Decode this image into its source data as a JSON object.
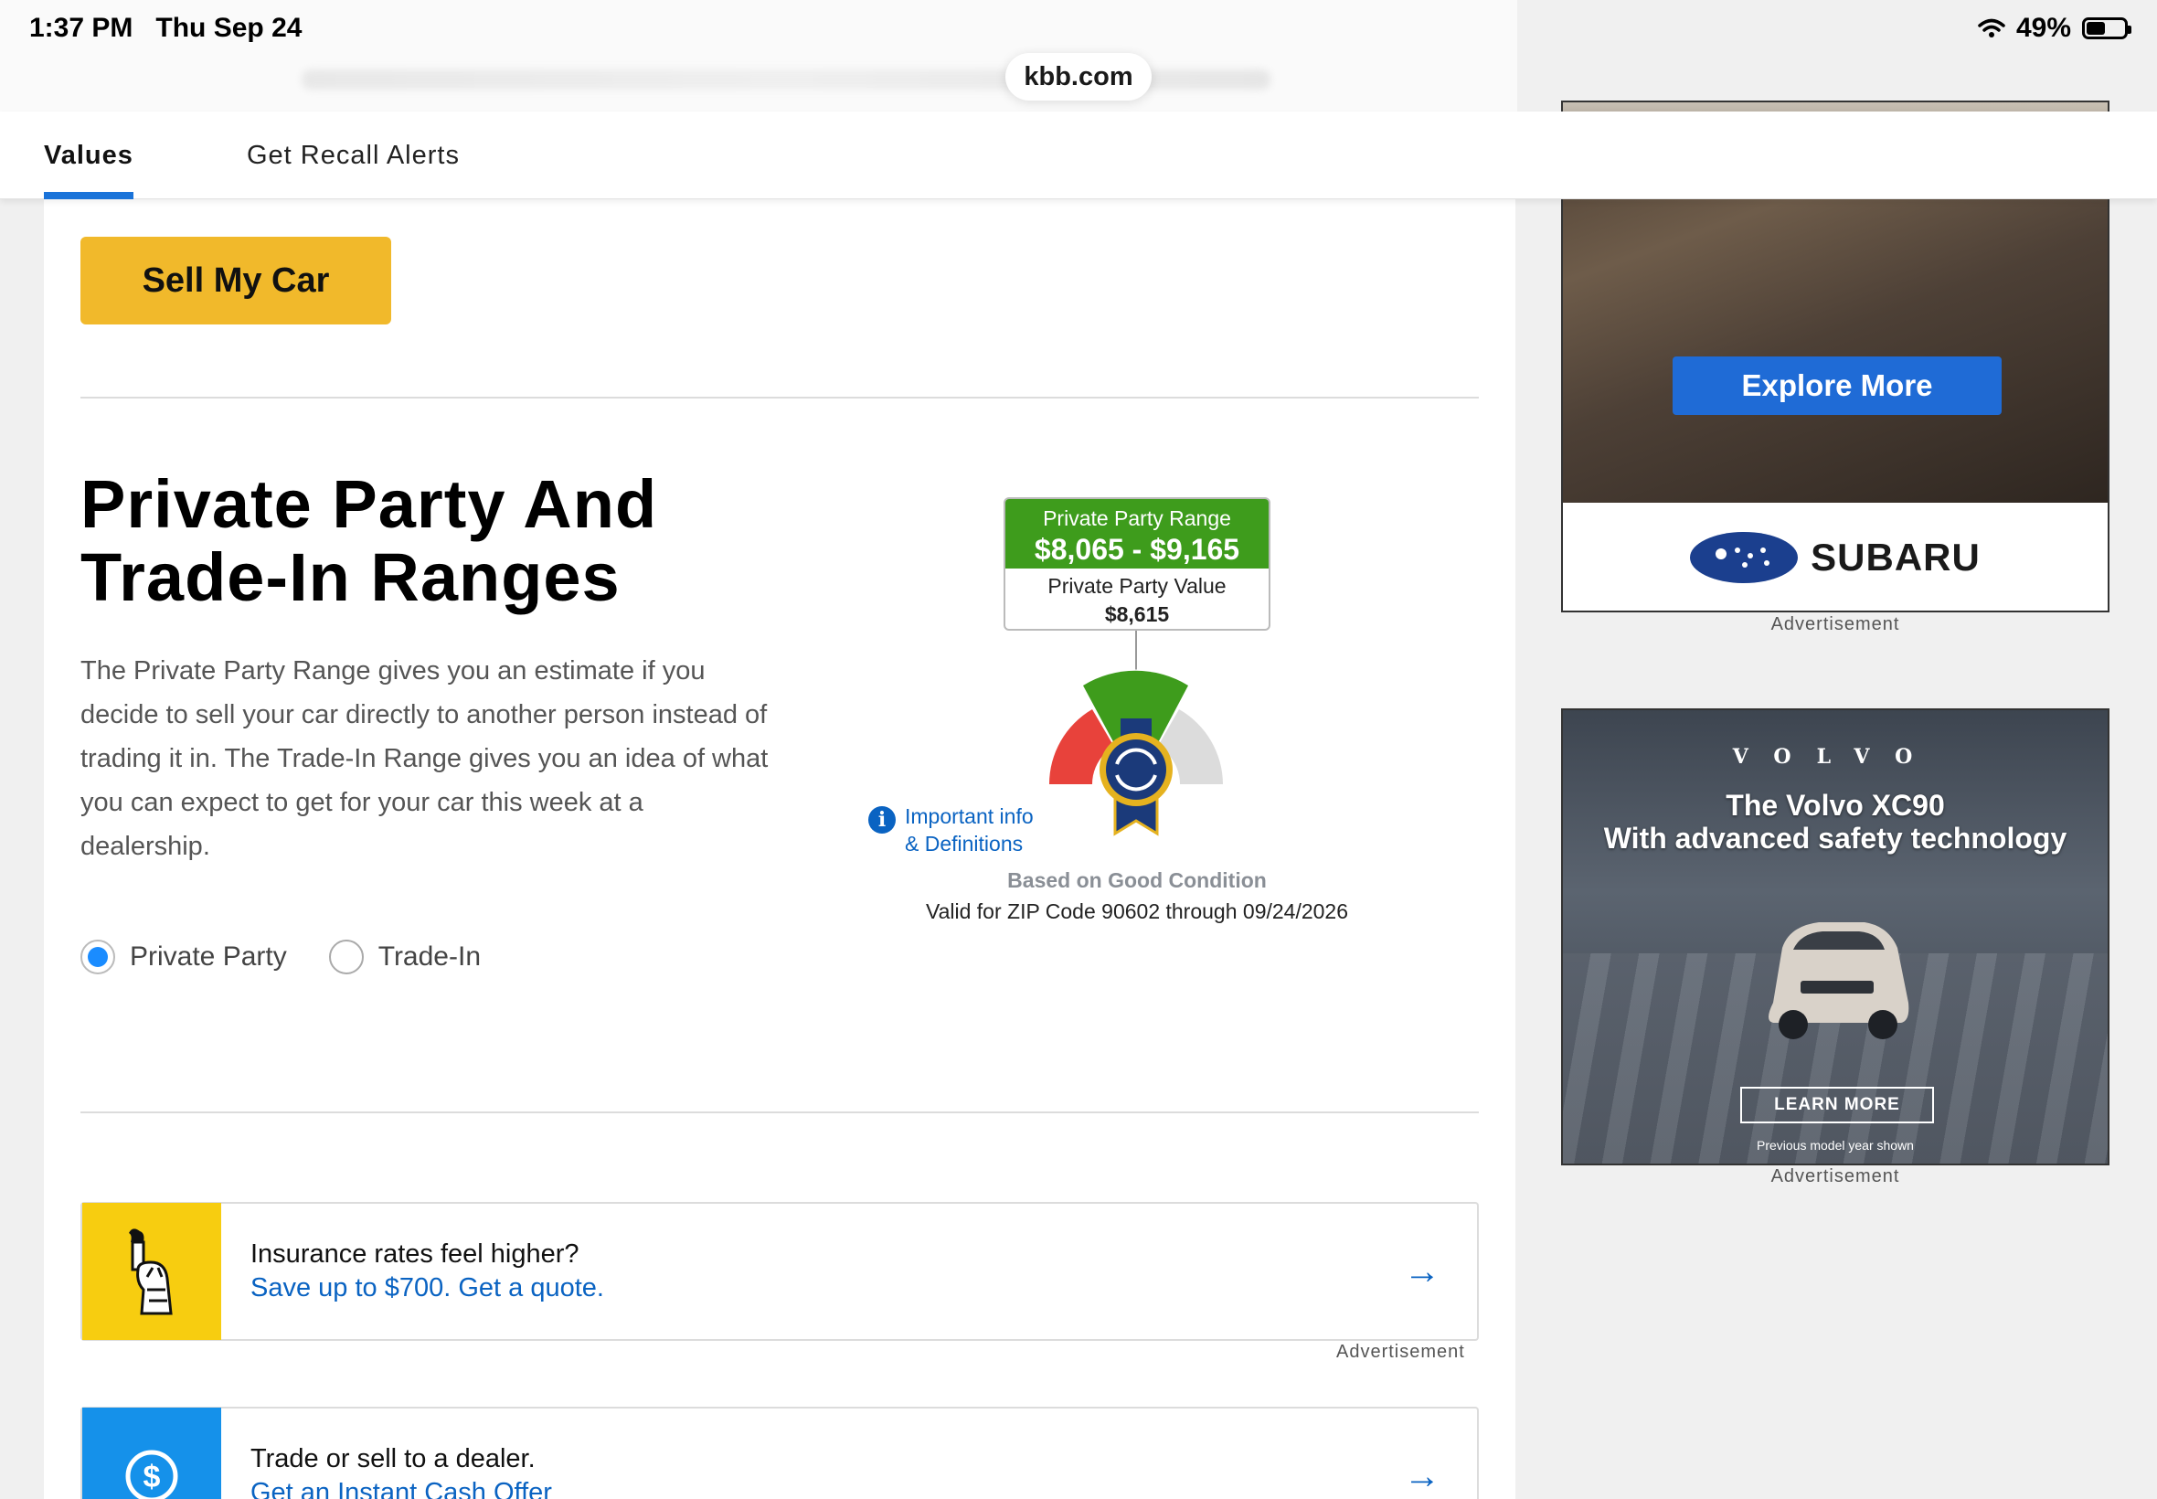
{
  "status_bar": {
    "time": "1:37 PM",
    "date": "Thu Sep 24",
    "battery": "49%",
    "battery_level": 0.49
  },
  "browser": {
    "url": "kbb.com"
  },
  "nav": {
    "tabs": [
      {
        "label": "Values",
        "active": true
      },
      {
        "label": "Get Recall Alerts",
        "active": false
      }
    ]
  },
  "sell_button": {
    "label": "Sell My Car"
  },
  "ranges_section": {
    "title": "Private Party And Trade-In Ranges",
    "description": "The Private Party Range gives you an estimate if you decide to sell your car directly to another person instead of trading it in. The Trade-In Range gives you an idea of what you can expect to get for your car this week at a dealership.",
    "options": [
      {
        "label": "Private Party",
        "checked": true
      },
      {
        "label": "Trade-In",
        "checked": false
      }
    ]
  },
  "value_graphic": {
    "range_label": "Private Party Range",
    "range_value": "$8,065 - $9,165",
    "value_label": "Private Party Value",
    "value": "$8,615",
    "info_link": "Important info & Definitions",
    "condition": "Based on Good Condition",
    "validity": "Valid for ZIP Code 90602 through 09/24/2026",
    "colors": {
      "range": "#3e9c1c",
      "poor": "#e8423b",
      "good": "#3e9c1c",
      "excellent": "#dcdcdc",
      "badge": "#1b3a7a"
    }
  },
  "promos": [
    {
      "line1": "Insurance rates feel higher?",
      "line2": "Save up to $700. Get a quote.",
      "icon": "statue-of-liberty-icon",
      "icon_bg": "#f7cd10",
      "ad_label": "Advertisement"
    },
    {
      "line1": "Trade or sell to a dealer.",
      "line2": "Get an Instant Cash Offer",
      "icon": "dollar-circle-icon",
      "icon_bg": "#1591ea"
    }
  ],
  "ads": {
    "subaru": {
      "button": "Explore More",
      "brand": "SUBARU",
      "label": "Advertisement"
    },
    "volvo": {
      "brand": "VOLVO",
      "headline_1": "The Volvo XC90",
      "headline_2": "With advanced safety technology",
      "button": "LEARN MORE",
      "note": "Previous model year shown",
      "label": "Advertisement"
    }
  }
}
